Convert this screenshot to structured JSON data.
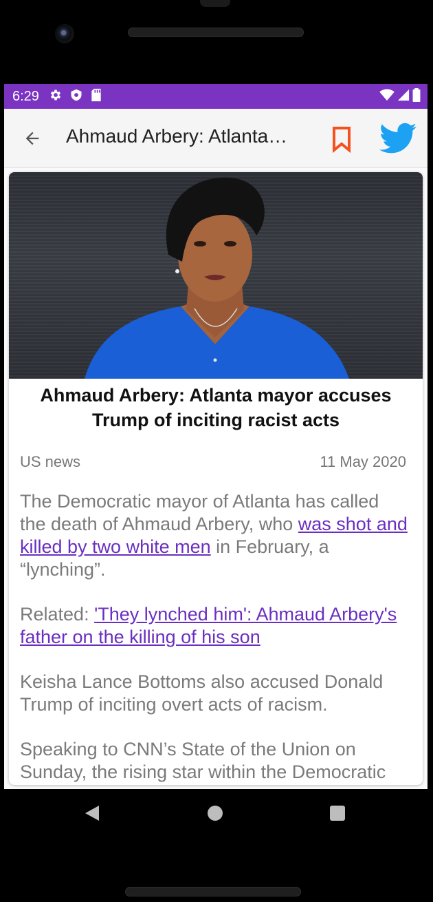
{
  "status_bar": {
    "time": "6:29",
    "left_icons": [
      "gear-icon",
      "shield-icon",
      "sd-card-icon"
    ],
    "right_icons": [
      "wifi-icon",
      "signal-icon",
      "battery-icon"
    ],
    "color": "#7b33c2"
  },
  "app_bar": {
    "title": "Ahmaud Arbery: Atlanta…",
    "back_icon": "arrow-left-icon",
    "bookmark_icon": "bookmark-icon",
    "share_icon": "twitter-icon",
    "bookmark_color": "#f4511e",
    "twitter_color": "#1da1f2"
  },
  "article": {
    "headline": "Ahmaud Arbery: Atlanta mayor accuses Trump of inciting racist acts",
    "section": "US news",
    "date": "11 May 2020",
    "p1_before": "The Democratic mayor of Atlanta has called the death of Ahmaud Arbery, who ",
    "p1_link": "was shot and killed by two white men",
    "p1_after": " in February, a “lynching”.",
    "p2_before": "Related: ",
    "p2_link": "'They lynched him': Ahmaud Arbery's father on the killing of his son",
    "p3": "Keisha Lance Bottoms also accused Donald Trump of inciting overt acts of racism.",
    "p4": "Speaking to CNN’s State of the Union on Sunday, the rising star within the Democratic",
    "link_color": "#6a2fc0"
  },
  "nav_bar": {
    "icons": [
      "back-triangle-icon",
      "home-circle-icon",
      "recents-square-icon"
    ]
  }
}
